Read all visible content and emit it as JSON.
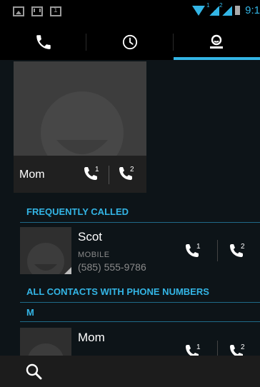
{
  "status_bar": {
    "time": "9:1",
    "icons": [
      "picture-icon",
      "gmail-icon",
      "calendar-icon",
      "wifi-icon",
      "signal-sim1-icon",
      "signal-sim2-icon",
      "battery-icon"
    ],
    "sim1": "1",
    "sim2": "2"
  },
  "tabs": [
    {
      "name": "phone-icon",
      "active": false
    },
    {
      "name": "recent-clock-icon",
      "active": false
    },
    {
      "name": "contacts-person-icon",
      "active": true
    }
  ],
  "favorite": {
    "name": "Mom",
    "sim1_badge": "1",
    "sim2_badge": "2"
  },
  "sections": {
    "frequently_called": "FREQUENTLY CALLED",
    "all_contacts": "ALL CONTACTS WITH PHONE NUMBERS",
    "letter_m": "M"
  },
  "frequent_contacts": [
    {
      "name": "Scot",
      "type": "MOBILE",
      "phone": "(585) 555-9786",
      "sim1_badge": "1",
      "sim2_badge": "2"
    }
  ],
  "contacts": [
    {
      "name": "Mom",
      "sim1_badge": "1",
      "sim2_badge": "2"
    }
  ],
  "colors": {
    "accent": "#33b5e5",
    "background": "#0d1418",
    "bar": "#000000",
    "bottom_bar": "#1c1c1c"
  }
}
